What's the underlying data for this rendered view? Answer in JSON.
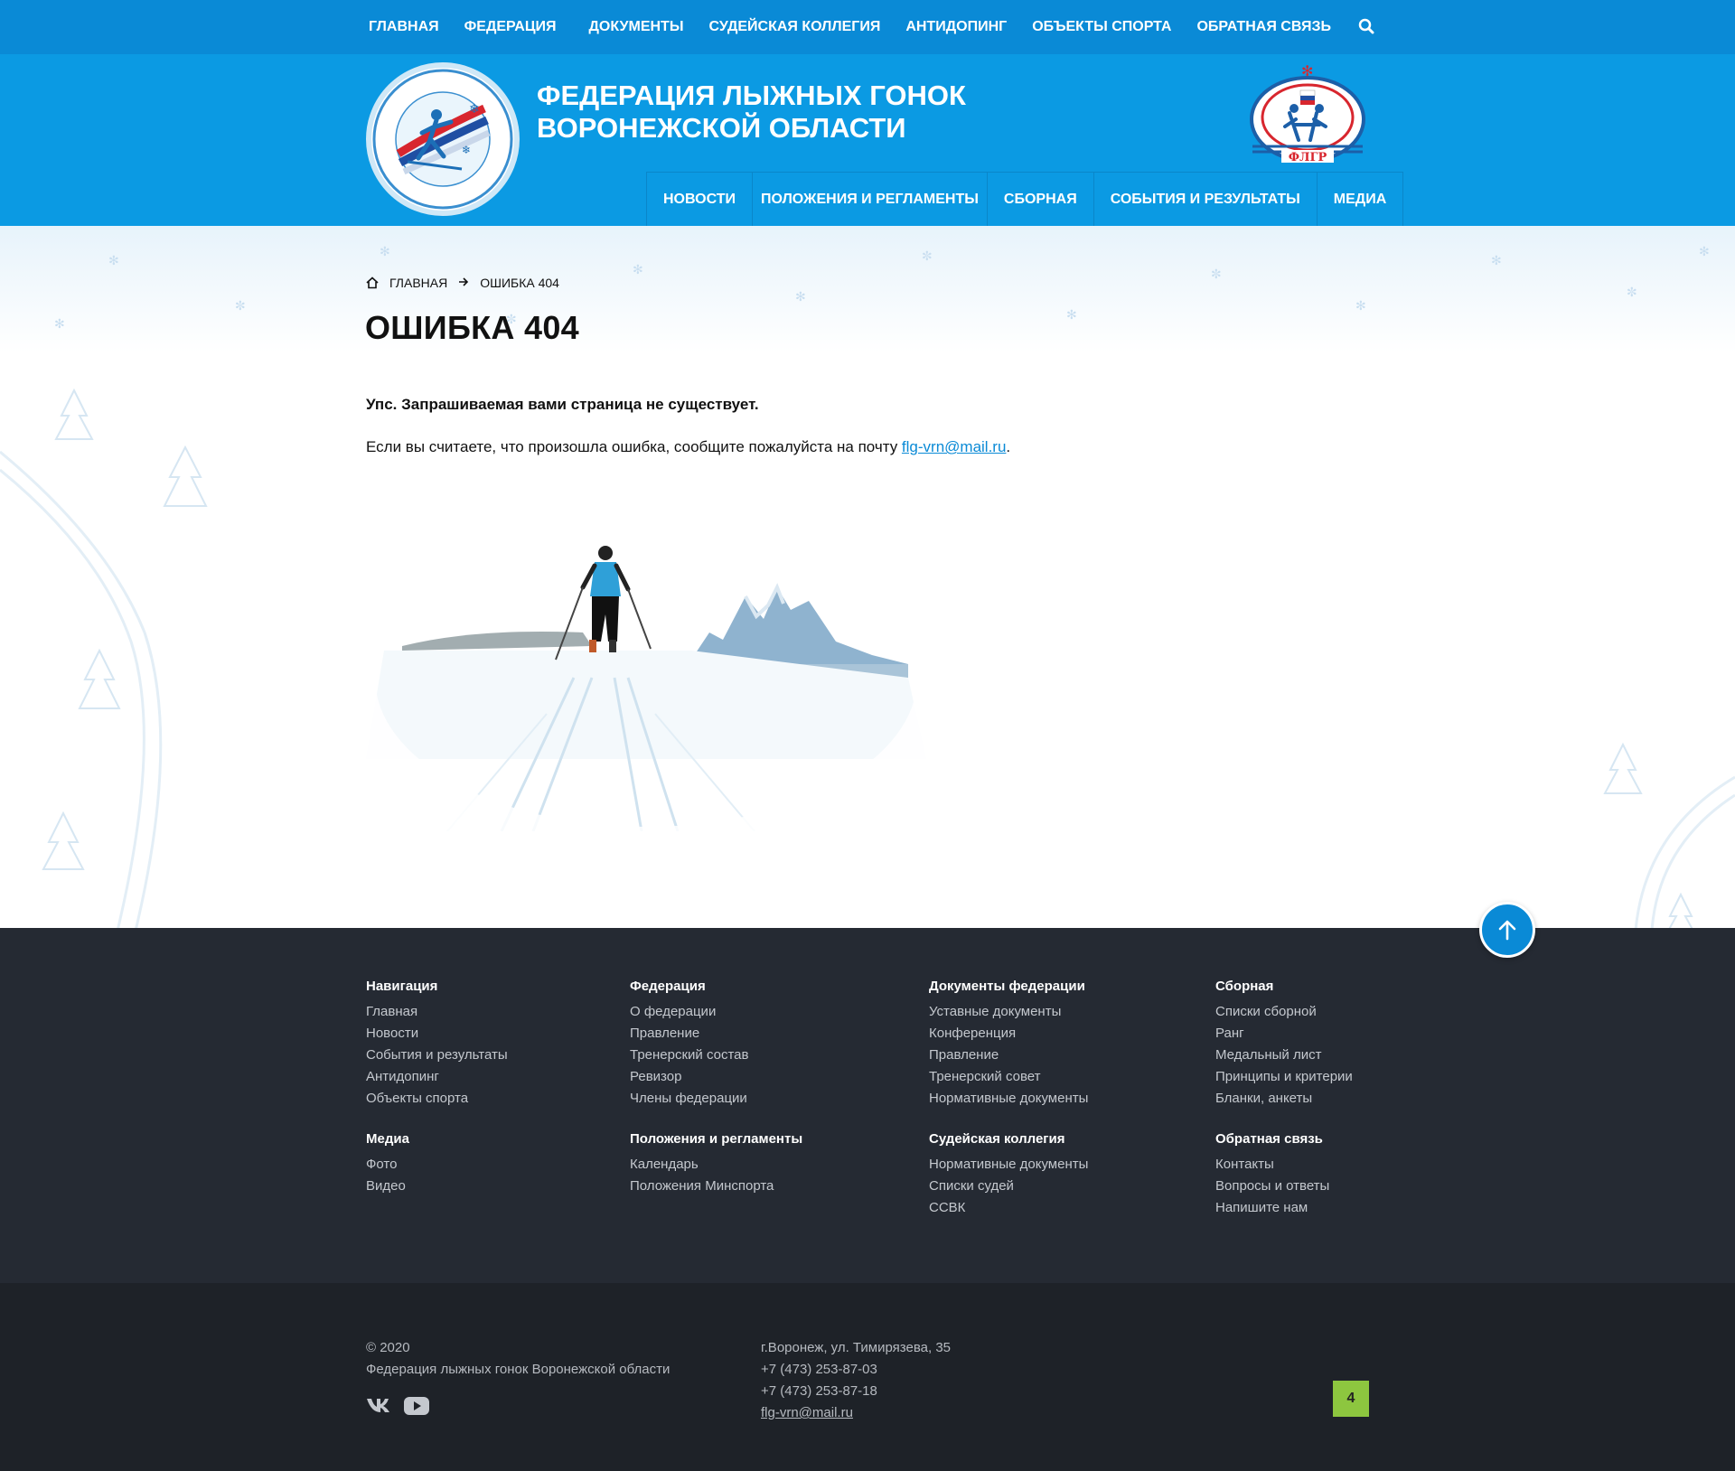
{
  "topnav": {
    "items": [
      "Главная",
      "Федерация",
      "Документы",
      "Судейская коллегия",
      "Антидопинг",
      "Объекты спорта",
      "Обратная связь"
    ]
  },
  "header": {
    "title_line1": "Федерация лыжных гонок",
    "title_line2": "Воронежской области",
    "logo_right_text": "ФЛГР"
  },
  "mainnav": {
    "items": [
      "Новости",
      "Положения и регламенты",
      "Сборная",
      "События и результаты",
      "Медиа"
    ]
  },
  "breadcrumb": {
    "home": "Главная",
    "current": "Ошибка 404"
  },
  "content": {
    "title": "Ошибка 404",
    "message_bold": "Упс. Запрашиваемая вами страница не существует.",
    "message_prefix": "Если вы считаете, что произошла ошибка, сообщите пожалуйста на почту ",
    "email": "flg-vrn@mail.ru",
    "message_suffix": "."
  },
  "footer": {
    "col1": {
      "g1_title": "Навигация",
      "g1_links": [
        "Главная",
        "Новости",
        "События и результаты",
        "Антидопинг",
        "Объекты спорта"
      ],
      "g2_title": "Медиа",
      "g2_links": [
        "Фото",
        "Видео"
      ]
    },
    "col2": {
      "g1_title": "Федерация",
      "g1_links": [
        "О федерации",
        "Правление",
        "Тренерский состав",
        "Ревизор",
        "Члены федерации"
      ],
      "g2_title": "Положения и регламенты",
      "g2_links": [
        "Календарь",
        "Положения Минспорта"
      ]
    },
    "col3": {
      "g1_title": "Документы федерации",
      "g1_links": [
        "Уставные документы",
        "Конференция",
        "Правление",
        "Тренерский совет",
        "Нормативные документы"
      ],
      "g2_title": "Судейская коллегия",
      "g2_links": [
        "Нормативные документы",
        "Списки судей",
        "ССВК"
      ]
    },
    "col4": {
      "g1_title": "Сборная",
      "g1_links": [
        "Списки сборной",
        "Ранг",
        "Медальный лист",
        "Принципы и критерии",
        "Бланки, анкеты"
      ],
      "g2_title": "Обратная связь",
      "g2_links": [
        "Контакты",
        "Вопросы и ответы",
        "Напишите нам"
      ]
    }
  },
  "bottom": {
    "copyright": "© 2020",
    "org": "Федерация лыжных гонок Воронежской области",
    "address": "г.Воронеж, ул. Тимирязева, 35",
    "phone1": "+7 (473) 253-87-03",
    "phone2": "+7 (473) 253-87-18",
    "email": "flg-vrn@mail.ru",
    "counter": "4"
  },
  "colors": {
    "topbar": "#0a8ad6",
    "header": "#0b9ae3",
    "footer": "#252a33",
    "bottom": "#1e2228",
    "link": "#0a8ad6",
    "counter": "#8dc63f"
  }
}
